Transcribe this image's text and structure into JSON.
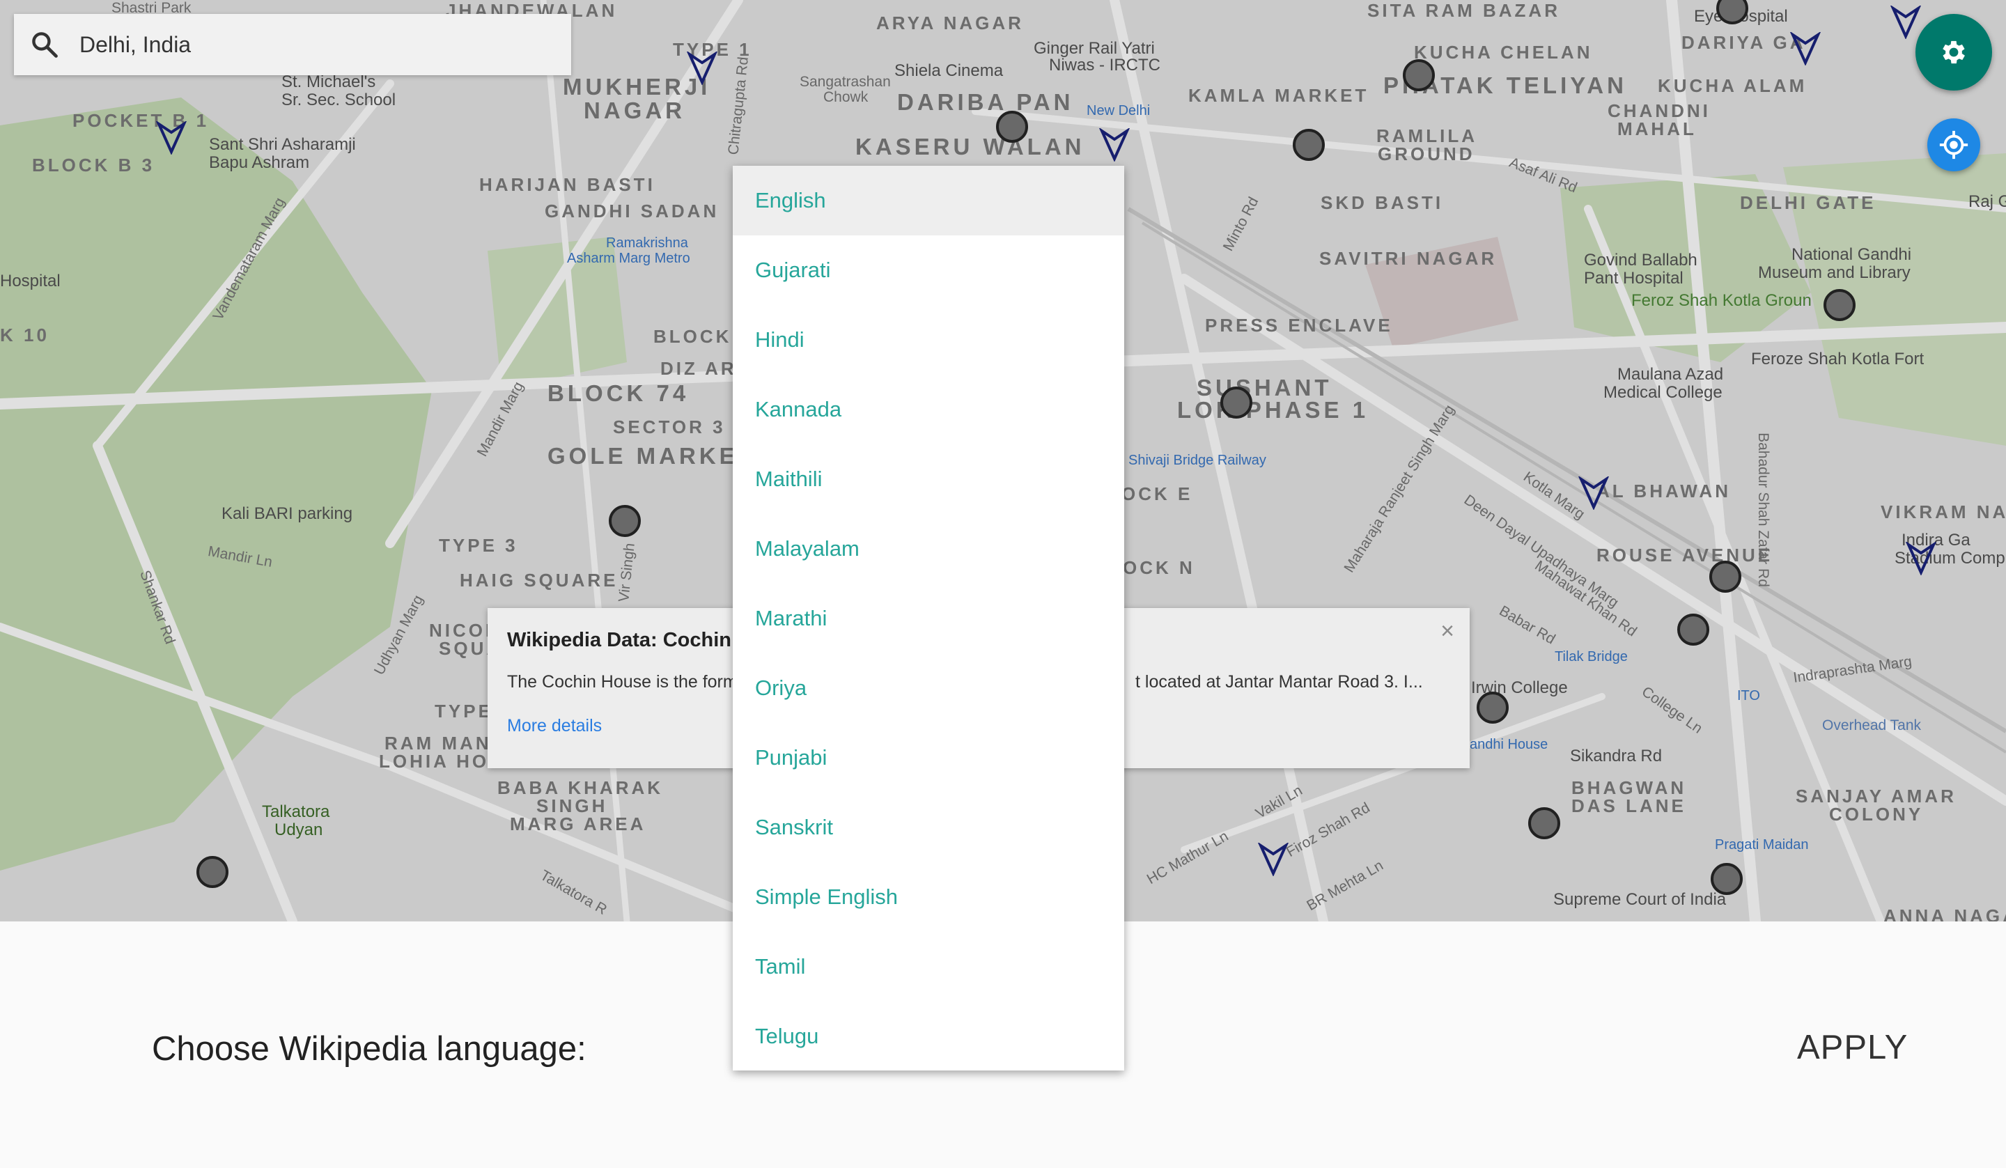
{
  "search": {
    "value": "Delhi, India",
    "icon": "search-icon"
  },
  "map": {
    "labels": {
      "shastri_park": "Shastri Park",
      "jhandewalan": "JHANDEWALAN",
      "arya_nagar": "ARYA NAGAR",
      "sita_ram_bazar": "SITA RAM BAZAR",
      "st_michaels": "St. Michael's",
      "sr_sec_school": "Sr. Sec. School",
      "mukherji": "MUKHERJI",
      "nagar": "NAGAR",
      "type1": "TYPE 1",
      "shiela_cinema": "Shiela Cinema",
      "sangatrashan": "Sangatrashan",
      "chowk": "Chowk",
      "dariba_pan": "DARIBA PAN",
      "ginger": "Ginger Rail Yatri",
      "niwas": "Niwas - IRCTC",
      "kucha_chelan": "KUCHA CHELAN",
      "dariya_ganj": "DARIYA GA",
      "kamla_market": "KAMLA MARKET",
      "phatak_teliyan": "PHATAK TELIYAN",
      "kucha_alam": "KUCHA ALAM",
      "chandni": "CHANDNI",
      "mahal": "MAHAL",
      "eye_hospital": "Eye Hospital",
      "pocket_b1": "POCKET B 1",
      "block_b3": "BLOCK B 3",
      "sant_shri": "Sant Shri Asharamji",
      "bapu_ashram": "Bapu Ashram",
      "kaseru_walan": "KASERU WALAN",
      "new_delhi": "New Delhi",
      "ramlila": "RAMLILA",
      "ground": "GROUND",
      "asaf_ali": "Asaf Ali Rd",
      "harijan_basti": "HARIJAN BASTI",
      "gandhi_sadan": "GANDHI SADAN",
      "skd_basti": "SKD BASTI",
      "delhi_gate": "DELHI GATE",
      "ramakrishna": "Ramakrishna",
      "asharm_marg": "Asharm Marg Metro",
      "savitri_nagar": "SAVITRI NAGAR",
      "govind": "Govind Ballabh",
      "pant_hospital": "Pant Hospital",
      "national_gandhi": "National Gandhi",
      "museum": "Museum and Library",
      "feroz_ground": "Feroz Shah Kotla Groun",
      "hospital": "Hospital",
      "vandemataram": "Vandemataram Marg",
      "minto_rd": "Minto Rd",
      "press_enclave": "PRESS ENCLAVE",
      "block_b10": "K 10",
      "block_a": "BLOCK A",
      "diz_area": "DIZ AR",
      "block74": "BLOCK 74",
      "sector3": "SECTOR 3",
      "gole_market": "GOLE MARKET",
      "sushant": "SUSHANT",
      "lok_phase": "LOK PHASE 1",
      "maulana": "Maulana Azad",
      "medical_college": "Medical College",
      "feroz_fort": "Feroze Shah Kotla Fort",
      "mandir_marg": "Mandir Marg",
      "shivaji_bridge": "Shivaji Bridge Railway",
      "kali_bari": "Kali BARI parking",
      "block_e": "OCK E",
      "kotla_marg": "Kotla Marg",
      "al_bhawan": "AL BHAWAN",
      "vikram_nag": "VIKRAM NAG",
      "indira_gandhi": "Indira Ga",
      "stadium": "Stadium Comp",
      "type3": "TYPE 3",
      "haig_square": "HAIG SQUARE",
      "mandir_ln": "Mandir Ln",
      "block_n": "OCK N",
      "deen_dayal": "Deen Dayal Upadhaya Marg",
      "rouse_avenue": "ROUSE AVENUE",
      "bahadur_shah": "Bahadur Shah Zafar Rd",
      "mahawat_khan": "Mahawat Khan Rd",
      "babar_rd": "Babar Rd",
      "tilak_bridge": "Tilak Bridge",
      "irwin_college": "Irwin College",
      "indraprastha": "Indraprashta Marg",
      "ito": "ITO",
      "overhead_tank": "Overhead Tank",
      "college_ln": "College Ln",
      "sikandra_rd": "Sikandra Rd",
      "bhagwan": "BHAGWAN",
      "das_lane": "DAS LANE",
      "sanjay_amar": "SANJAY AMAR",
      "colony": "COLONY",
      "pragati_maidan": "Pragati Maidan",
      "ram_manohar": "RAM MANO",
      "lohia": "LOHIA HOS",
      "baba_kharak": "BABA KHARAK",
      "singh": "SINGH",
      "marg_area": "MARG AREA",
      "talkatora": "Talkatora",
      "udyan": "Udyan",
      "talkatora_rd": "Talkatora R",
      "shankar_rd": "Shankar Rd",
      "udhyan_marg": "Udhyan Marg",
      "nicol": "NICOL",
      "squa": "SQUA",
      "type_e": "TYPE",
      "hc_mathur": "HC Mathur Ln",
      "feroz_shah_rd": "Firoz Shah Rd",
      "vakil_ln": "Vakil Ln",
      "br_mehta": "BR Mehta Ln",
      "supreme_court": "Supreme Court of India",
      "anna_naga": "ANNA NAGA",
      "andhi_house": "andhi House",
      "maharaja": "Maharaja Ranjeet Singh Marg",
      "chitragupta": "Chitragupta Rd",
      "vir_singh": "Vir Singh",
      "raj_g": "Raj G"
    }
  },
  "info_window": {
    "title": "Wikipedia Data: Cochin H",
    "body_left": "The Cochin House is the form",
    "body_right": "t located at Jantar Mantar Road 3. I...",
    "more_link": "More details",
    "close_label": "×"
  },
  "fab": {
    "settings_icon": "gear-icon",
    "locate_icon": "my-location-icon"
  },
  "bottom": {
    "label": "Choose Wikipedia language:",
    "apply": "APPLY"
  },
  "languages": {
    "selected": "English",
    "options": [
      "English",
      "Gujarati",
      "Hindi",
      "Kannada",
      "Maithili",
      "Malayalam",
      "Marathi",
      "Oriya",
      "Punjabi",
      "Sanskrit",
      "Simple English",
      "Tamil",
      "Telugu"
    ]
  },
  "colors": {
    "accent": "#26a69a",
    "settings_fab": "#00796b",
    "locate_fab": "#1e88e5",
    "link": "#2a7de1"
  }
}
